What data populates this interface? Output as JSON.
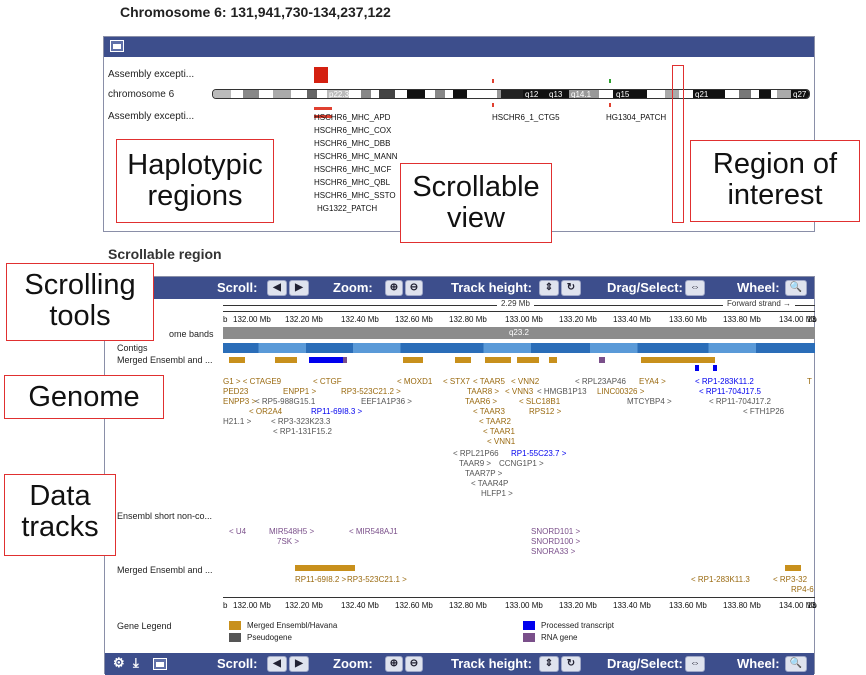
{
  "title": "Chromosome 6: 131,941,730-134,237,122",
  "overview": {
    "rows": [
      "Assembly excepti...",
      "chromosome 6",
      "Assembly excepti..."
    ],
    "bands": [
      "p22.3",
      "q12",
      "q13",
      "q14.1",
      "q15",
      "q21",
      "q27"
    ],
    "haplotypes": [
      "HSCHR6_MHC_APD",
      "HSCHR6_MHC_COX",
      "HSCHR6_MHC_DBB",
      "HSCHR6_MHC_MANN",
      "HSCHR6_MHC_MCF",
      "HSCHR6_MHC_QBL",
      "HSCHR6_MHC_SSTO",
      "HG1322_PATCH"
    ],
    "patches": [
      "HSCHR6_1_CTG5",
      "HG1304_PATCH"
    ]
  },
  "scroll_title": "Scrollable region",
  "callouts": {
    "haplotypic": "Haplotypic\nregions",
    "scrollable": "Scrollable\nview",
    "region": "Region of\ninterest",
    "scrolling": "Scrolling\ntools",
    "genome": "Genome",
    "data": "Data\ntracks"
  },
  "toolbar": {
    "scroll": "Scroll:",
    "zoom": "Zoom:",
    "track_height": "Track height:",
    "drag": "Drag/Select:",
    "wheel": "Wheel:"
  },
  "ruler": {
    "length": "2.29 Mb",
    "strand": "Forward strand",
    "ticks": [
      "b",
      "132.00 Mb",
      "132.20 Mb",
      "132.40 Mb",
      "132.60 Mb",
      "132.80 Mb",
      "133.00 Mb",
      "133.20 Mb",
      "133.40 Mb",
      "133.60 Mb",
      "133.80 Mb",
      "134.00 Mb",
      "13"
    ]
  },
  "tracks": {
    "chromosome_bands": "ome bands",
    "band_label": "q23.2",
    "contigs": "Contigs",
    "merged_top": "Merged Ensembl and ...",
    "short_noncoding": "Ensembl short non-co...",
    "merged_bottom": "Merged Ensembl and ...",
    "gene_legend": "Gene Legend"
  },
  "genes_top": [
    "G1 > < CTAGE9",
    "ENPP1 >",
    "< CTGF",
    "< MOXD1",
    "< STX7",
    "< TAAR5",
    "< VNN2",
    "< RPL23AP46",
    "EYA4 >",
    "< RP1-283K11.2",
    "T",
    "PED23",
    "< RP5-988G15.1",
    "RP3-523C21.2 >",
    "TAAR8 >",
    "< VNN3",
    "< HMGB1P13",
    "LINC00326 >",
    "< RP11-704J17.5",
    "ENPP3 >",
    "< OR2A4",
    "RP11-69I8.3 >",
    "EEF1A1P36 >",
    "TAAR6 >",
    "< SLC18B1",
    "MTCYBP4 >",
    "< RP11-704J17.2",
    "H21.1 >",
    "< RP3-323K23.3",
    "< TAAR3",
    "RPS12 >",
    "< FTH1P26",
    "< RP1-131F15.2",
    "< TAAR2",
    "< TAAR1",
    "< VNN1",
    "< RPL21P66",
    "RP1-55C23.7 >",
    "TAAR9 >",
    "CCNG1P1 >",
    "TAAR7P >",
    "< TAAR4P",
    "HLFP1 >"
  ],
  "genes_short": [
    "< U4",
    "MIR548H5 >",
    "7SK >",
    "< MIR548AJ1",
    "SNORD101 >",
    "SNORD100 >",
    "SNORA33 >"
  ],
  "genes_bottom": [
    "RP11-69I8.2 >",
    "RP3-523C21.1 >",
    "< RP1-283K11.3",
    "< RP3-32",
    "RP4-6"
  ],
  "legend": [
    {
      "label": "Merged Ensembl/Havana",
      "color": "#c8901c"
    },
    {
      "label": "Pseudogene",
      "color": "#555555"
    },
    {
      "label": "Processed transcript",
      "color": "#0000ee"
    },
    {
      "label": "RNA gene",
      "color": "#7a4f8a"
    }
  ],
  "colors": {
    "toolbar": "#3d4e8c",
    "merged": "#c8901c",
    "processed": "#0000ee",
    "rna": "#7a4f8a",
    "callout_border": "#e03030"
  }
}
